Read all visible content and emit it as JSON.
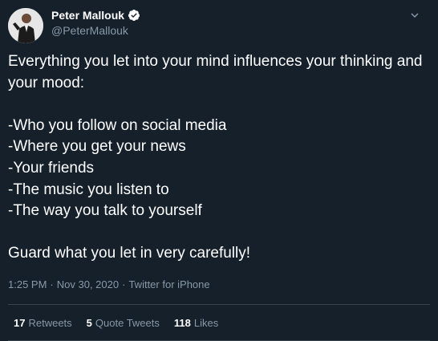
{
  "tweet": {
    "author": {
      "display_name": "Peter Mallouk",
      "handle": "@PeterMallouk",
      "verified_icon": "verified-badge-icon"
    },
    "text": "Everything you let into your mind influences your thinking and your mood:\n\n-Who you follow on social media\n-Where you get your news\n-Your friends\n-The music you listen to\n-The way you talk to yourself\n\nGuard what you let in very carefully!",
    "time": "1:25 PM",
    "date": "Nov 30, 2020",
    "source": "Twitter for iPhone",
    "separator": "·",
    "stats": {
      "retweets_count": "17",
      "retweets_label": "Retweets",
      "quotes_count": "5",
      "quotes_label": "Quote Tweets",
      "likes_count": "118",
      "likes_label": "Likes"
    }
  },
  "colors": {
    "background": "#15202b",
    "secondary_text": "#8899a6",
    "accent": "#1da1f2",
    "divider": "#38444d"
  }
}
